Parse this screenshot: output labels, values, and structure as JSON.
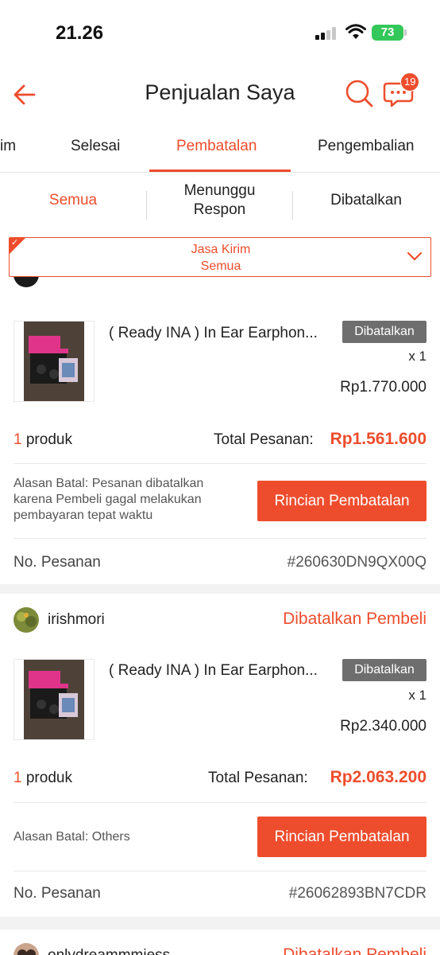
{
  "status_bar": {
    "time": "21.26",
    "battery": "73"
  },
  "header": {
    "title": "Penjualan Saya",
    "chat_badge": "19"
  },
  "tabs": [
    {
      "label": "im"
    },
    {
      "label": "Selesai"
    },
    {
      "label": "Pembatalan"
    },
    {
      "label": "Pengembalian"
    }
  ],
  "subtabs": [
    {
      "label": "Semua"
    },
    {
      "label": "Menunggu Respon"
    },
    {
      "label": "Dibatalkan"
    }
  ],
  "filter": {
    "line1": "Jasa Kirim",
    "line2": "Semua"
  },
  "orders": [
    {
      "shop_name": "",
      "status": "",
      "product_title": "( Ready INA ) In Ear Earphon...",
      "badge": "Dibatalkan",
      "qty": "x 1",
      "price": "Rp1.770.000",
      "count_num": "1",
      "count_label": "produk",
      "total_label": "Total Pesanan:",
      "total": "Rp1.561.600",
      "reason": "Alasan Batal: Pesanan dibatalkan karena Pembeli gagal melakukan pembayaran tepat waktu",
      "button": "Rincian Pembatalan",
      "order_label": "No. Pesanan",
      "order_no": "#260630DN9QX00Q"
    },
    {
      "shop_name": "irishmori",
      "status": "Dibatalkan Pembeli",
      "product_title": "( Ready INA ) In Ear Earphon...",
      "badge": "Dibatalkan",
      "qty": "x 1",
      "price": "Rp2.340.000",
      "count_num": "1",
      "count_label": "produk",
      "total_label": "Total Pesanan:",
      "total": "Rp2.063.200",
      "reason": "Alasan Batal: Others",
      "button": "Rincian Pembatalan",
      "order_label": "No. Pesanan",
      "order_no": "#26062893BN7CDR"
    },
    {
      "shop_name": "onlydreammmiess",
      "status": "Dibatalkan Pembeli"
    }
  ],
  "colors": {
    "accent": "#ee4d2d",
    "badge_grey": "#6e6e6e",
    "separator": "#f2f2f2"
  }
}
